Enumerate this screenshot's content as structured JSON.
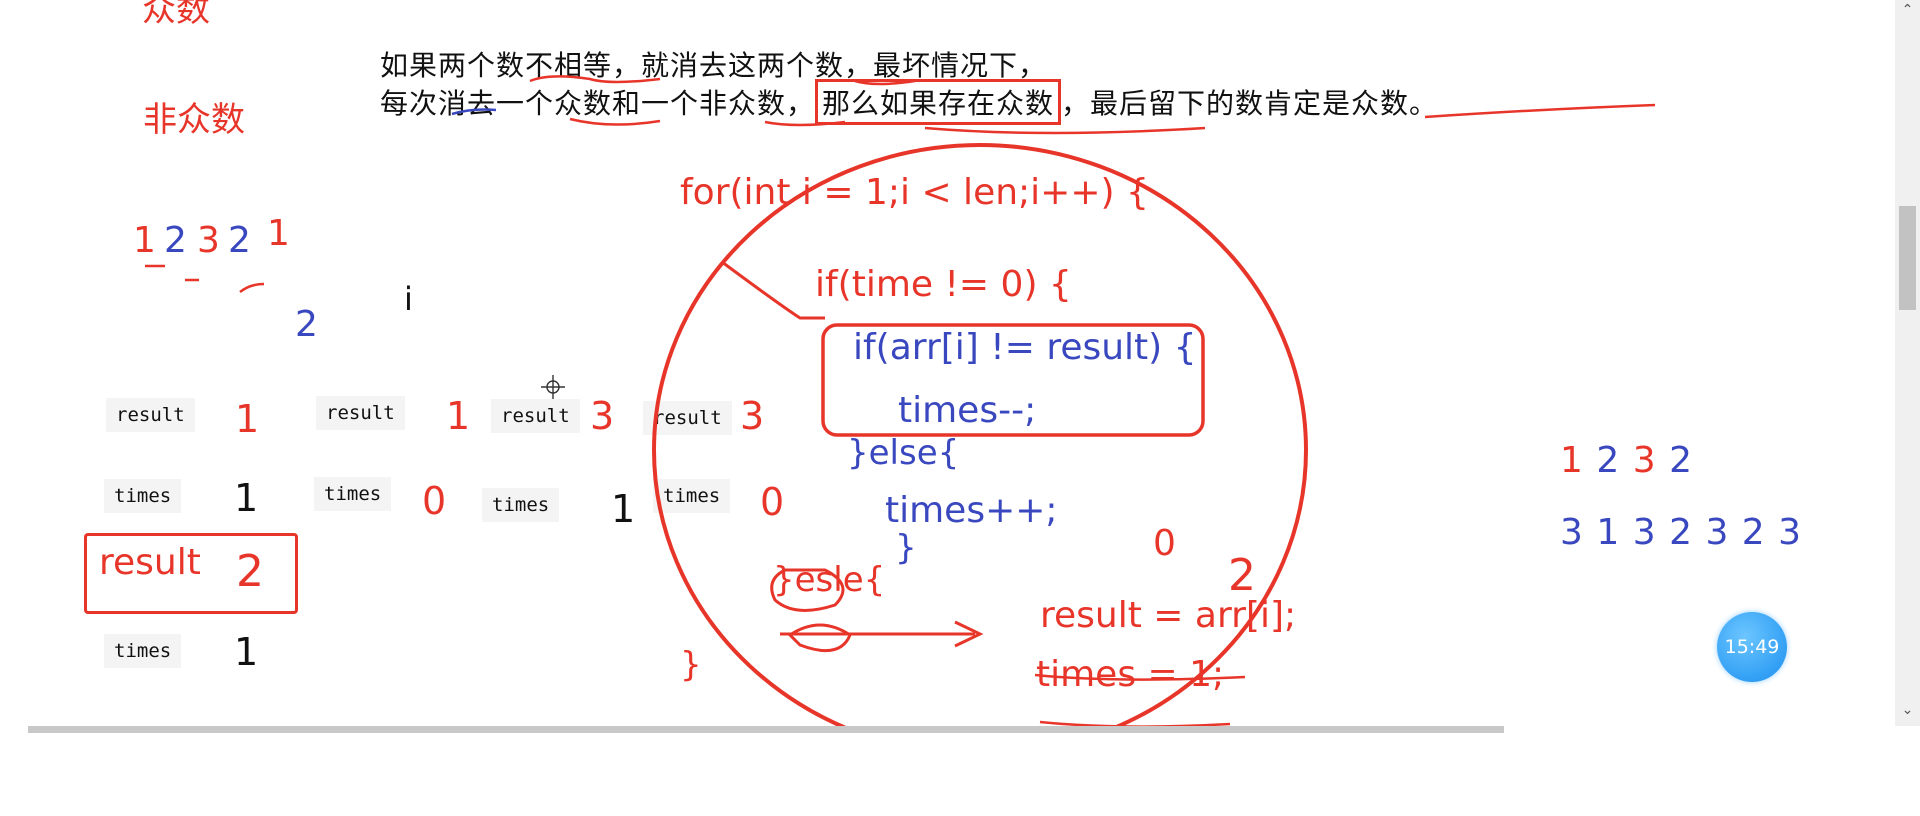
{
  "labels": {
    "top_cut": "众数",
    "nonmajority": "非众数"
  },
  "description": {
    "line1": "如果两个数不相等，就消去这两个数，最坏情况下，",
    "line2_a": "每次消去一个众数和一个非众数，",
    "line2_box": "那么如果存在众数",
    "line2_c": "，最后留下的数肯定是众数。"
  },
  "example": {
    "n1": "1",
    "n2": "2",
    "n3": "3",
    "n4": "2",
    "n5": "1",
    "below": "2",
    "pointer": "i"
  },
  "trace": {
    "result_label": "result",
    "times_label": "times",
    "col1": {
      "result": "1",
      "times": "1"
    },
    "col2": {
      "result": "1",
      "times": "0"
    },
    "col3": {
      "result": "3",
      "times": "1"
    },
    "col4": {
      "result": "3",
      "times": "0"
    },
    "final": {
      "result": "2",
      "times": "1"
    }
  },
  "code": {
    "for_line": "for(int i = 1;i < len;i++) {",
    "if_time": "if(time != 0) {",
    "if_arr": "if(arr[i] != result) {",
    "times_dec": "times--;",
    "else1": "}else{",
    "times_inc": "times++;",
    "close1": "}",
    "else2": "}esle{",
    "zero": "0",
    "two": "2",
    "assign_result": "result = arr[i];",
    "assign_times": "times = 1;",
    "close2": "}"
  },
  "sequences": {
    "seq1": [
      "1",
      "2",
      "3",
      "2"
    ],
    "seq2": [
      "3",
      "1",
      "3",
      "2",
      "3",
      "2",
      "3"
    ]
  },
  "colors": {
    "red": "#e8352a",
    "blue": "#3a48bf",
    "timer_bg": "#2a9af5"
  },
  "timer": {
    "text": "15:49"
  }
}
